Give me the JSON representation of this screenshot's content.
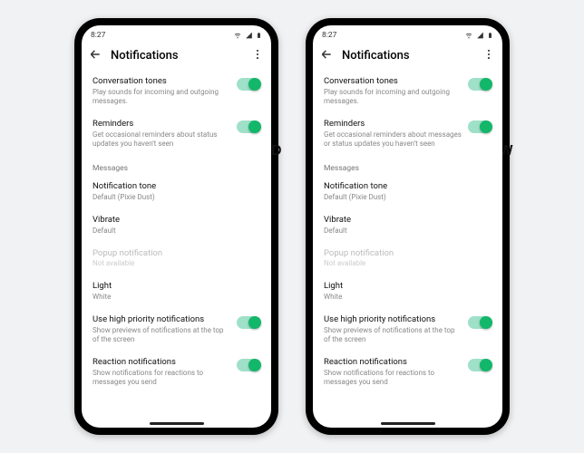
{
  "status_time": "8:27",
  "header": {
    "title": "Notifications"
  },
  "phones": [
    {
      "tag": "OLD",
      "rows": {
        "tones": {
          "title": "Conversation tones",
          "sub": "Play sounds for incoming and outgoing messages."
        },
        "reminders": {
          "title": "Reminders",
          "sub": "Get occasional reminders about status updates you haven't seen"
        },
        "section": "Messages",
        "notif_tone": {
          "title": "Notification tone",
          "sub": "Default (Pixie Dust)"
        },
        "vibrate": {
          "title": "Vibrate",
          "sub": "Default"
        },
        "popup": {
          "title": "Popup notification",
          "sub": "Not available"
        },
        "light": {
          "title": "Light",
          "sub": "White"
        },
        "high_prio": {
          "title": "Use high priority notifications",
          "sub": "Show previews of notifications at the top of the screen"
        },
        "reaction": {
          "title": "Reaction notifications",
          "sub": "Show notifications for reactions to messages you send"
        }
      }
    },
    {
      "tag": "NEW",
      "rows": {
        "tones": {
          "title": "Conversation tones",
          "sub": "Play sounds for incoming and outgoing messages."
        },
        "reminders": {
          "title": "Reminders",
          "sub": "Get occasional reminders about messages or status updates you haven't seen"
        },
        "section": "Messages",
        "notif_tone": {
          "title": "Notification tone",
          "sub": "Default (Pixie Dust)"
        },
        "vibrate": {
          "title": "Vibrate",
          "sub": "Default"
        },
        "popup": {
          "title": "Popup notification",
          "sub": "Not available"
        },
        "light": {
          "title": "Light",
          "sub": "White"
        },
        "high_prio": {
          "title": "Use high priority notifications",
          "sub": "Show previews of notifications at the top of the screen"
        },
        "reaction": {
          "title": "Reaction notifications",
          "sub": "Show notifications for reactions to messages you send"
        }
      }
    }
  ]
}
